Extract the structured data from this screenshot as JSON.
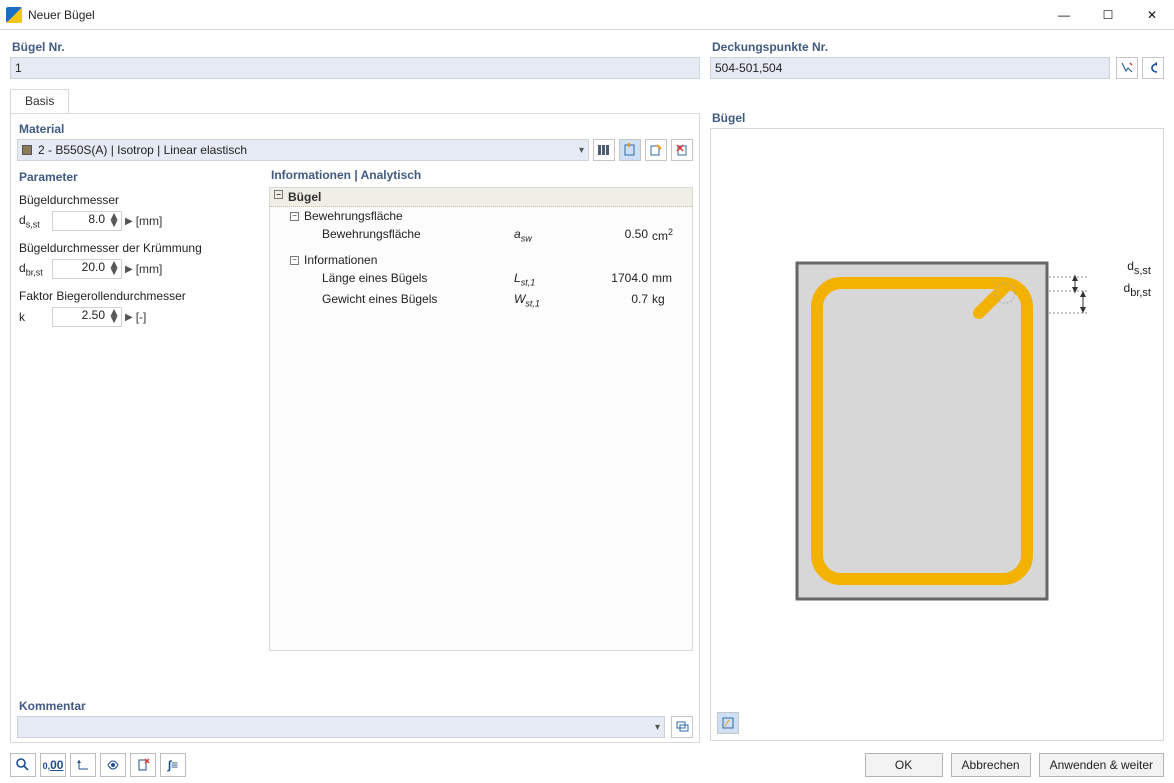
{
  "window": {
    "title": "Neuer Bügel"
  },
  "win_ctls": {
    "min": "—",
    "max": "☐",
    "close": "✕"
  },
  "header": {
    "bugel_nr_label": "Bügel Nr.",
    "bugel_nr_value": "1",
    "deck_label": "Deckungspunkte Nr.",
    "deck_value": "504-501,504"
  },
  "tabs": {
    "basis": "Basis"
  },
  "material": {
    "label": "Material",
    "value": "2 - B550S(A) | Isotrop | Linear elastisch"
  },
  "parameter": {
    "label": "Parameter",
    "d_sst_label": "Bügeldurchmesser",
    "d_sst_sym": "d",
    "d_sst_sub": "s,st",
    "d_sst_val": "8.0",
    "d_sst_unit": "[mm]",
    "d_brst_label": "Bügeldurchmesser der Krümmung",
    "d_brst_sym": "d",
    "d_brst_sub": "br,st",
    "d_brst_val": "20.0",
    "d_brst_unit": "[mm]",
    "k_label": "Faktor Biegerollendurchmesser",
    "k_sym": "k",
    "k_val": "2.50",
    "k_unit": "[-]"
  },
  "info": {
    "label": "Informationen | Analytisch",
    "root": "Bügel",
    "g1": "Bewehrungsfläche",
    "row1": {
      "name": "Bewehrungsfläche",
      "sym": "a",
      "sub": "sw",
      "val": "0.50",
      "unit": "cm",
      "unitsup": "2"
    },
    "g2": "Informationen",
    "row2": {
      "name": "Länge eines Bügels",
      "sym": "L",
      "sub": "st,1",
      "val": "1704.0",
      "unit": "mm"
    },
    "row3": {
      "name": "Gewicht eines Bügels",
      "sym": "W",
      "sub": "st,1",
      "val": "0.7",
      "unit": "kg"
    }
  },
  "preview": {
    "label": "Bügel",
    "annot1": "d",
    "annot1_sub": "s,st",
    "annot2": "d",
    "annot2_sub": "br,st"
  },
  "kommentar": {
    "label": "Kommentar"
  },
  "buttons": {
    "ok": "OK",
    "cancel": "Abbrechen",
    "apply": "Anwenden & weiter"
  }
}
